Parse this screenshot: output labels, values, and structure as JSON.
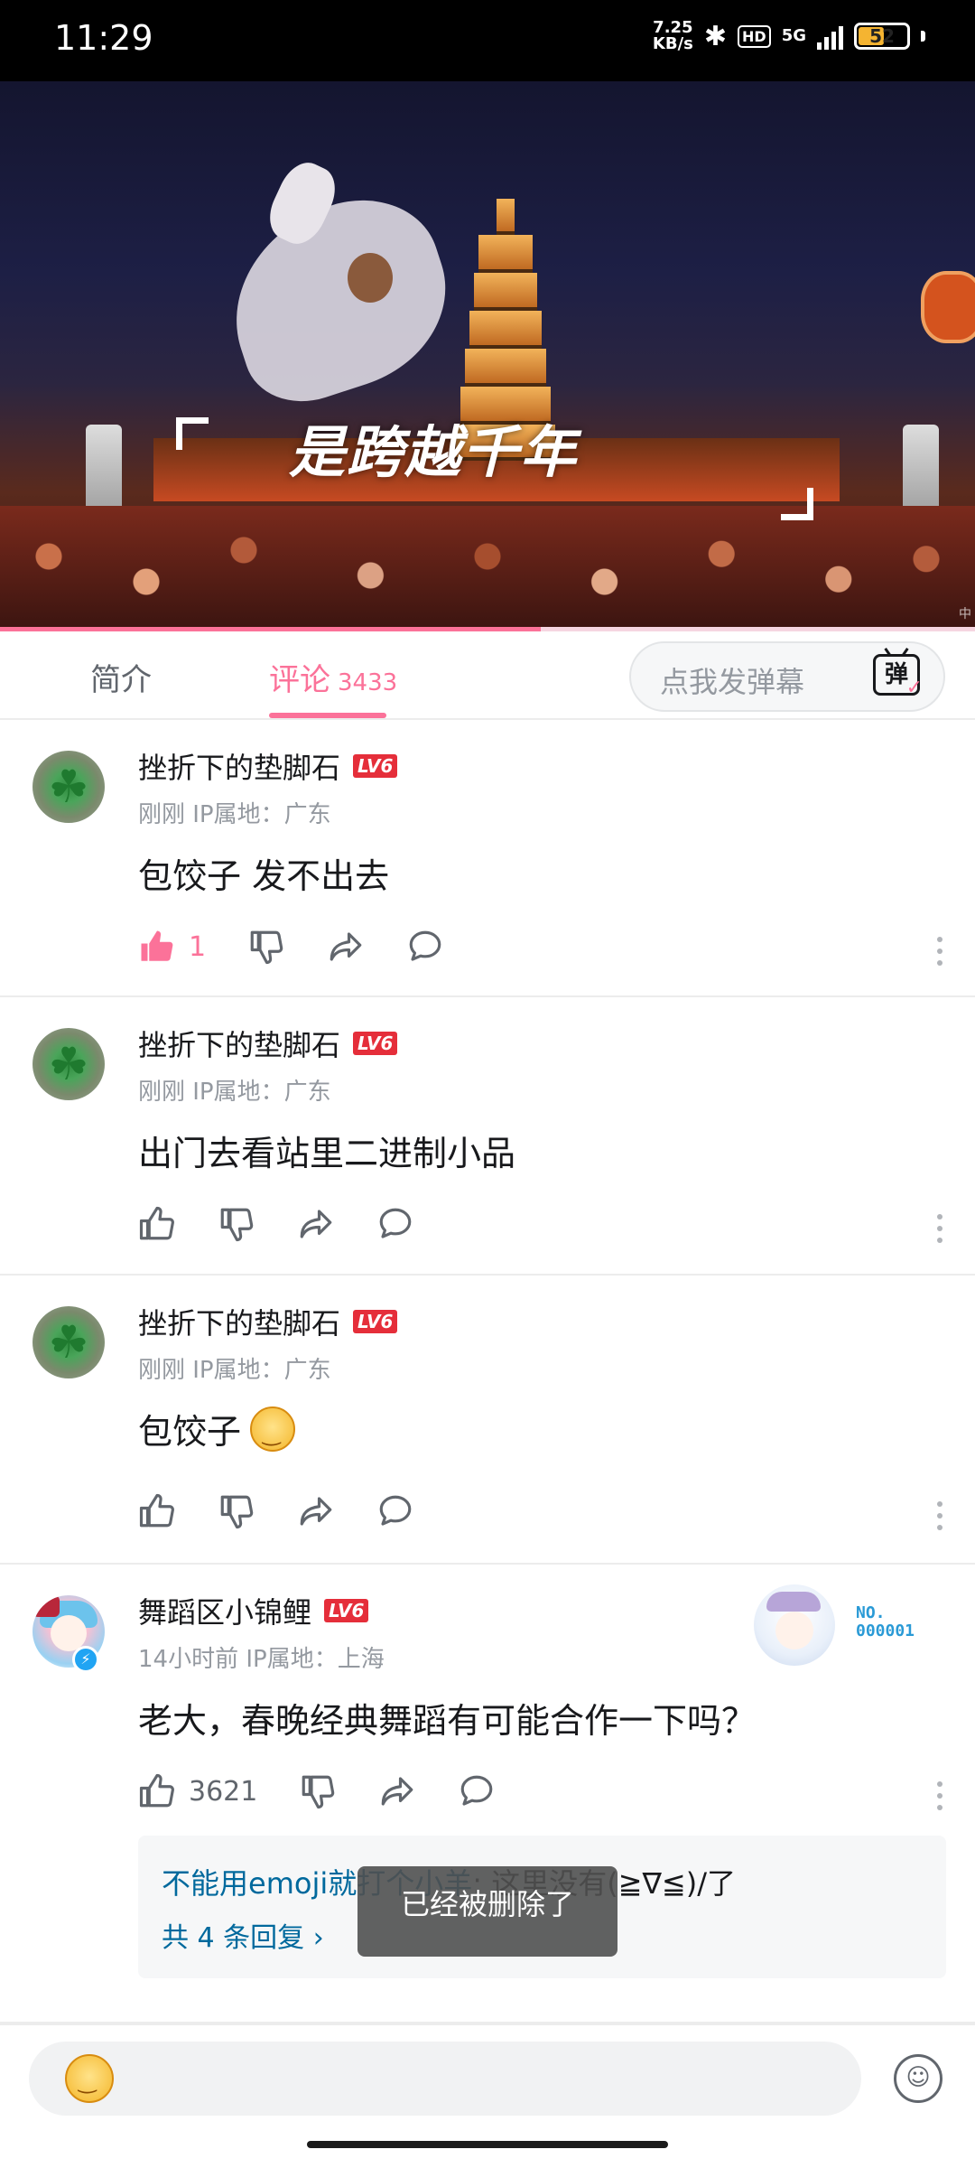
{
  "status_bar": {
    "time": "11:29",
    "net_speed_value": "7.25",
    "net_speed_unit": "KB/s",
    "hd": "HD",
    "network": "5G",
    "battery": "52"
  },
  "video": {
    "caption": "是跨越千年",
    "watermark": "中",
    "progress_fraction": 0.555
  },
  "tabs": {
    "intro": "简介",
    "comments": "评论",
    "comments_count": "3433",
    "danmaku_placeholder": "点我发弹幕",
    "danmaku_icon_label": "弹"
  },
  "comments": [
    {
      "user": "挫折下的垫脚石",
      "level": "LV6",
      "meta": "刚刚 IP属地：广东",
      "content": "包饺子 发不出去",
      "like_count": "1",
      "liked": true
    },
    {
      "user": "挫折下的垫脚石",
      "level": "LV6",
      "meta": "刚刚 IP属地：广东",
      "content": "出门去看站里二进制小品",
      "like_count": ""
    },
    {
      "user": "挫折下的垫脚石",
      "level": "LV6",
      "meta": "刚刚 IP属地：广东",
      "content": "包饺子",
      "like_count": ""
    },
    {
      "user": "舞蹈区小锦鲤",
      "level": "LV6",
      "meta": "14小时前 IP属地：上海",
      "content": "老大，春晚经典舞蹈有可能合作一下吗？",
      "like_count": "3621",
      "fan_no_label": "NO.",
      "fan_no_value": "000001",
      "reply": {
        "user": "不能用emoji就打个小羊",
        "text": ": 这里没有(≧∇≦)/了",
        "more": "共 4 条回复 ›"
      }
    }
  ],
  "toast": "已经被删除了",
  "colors": {
    "accent": "#fb7299",
    "link": "#00699d",
    "level_badge": "#e52e3a"
  }
}
